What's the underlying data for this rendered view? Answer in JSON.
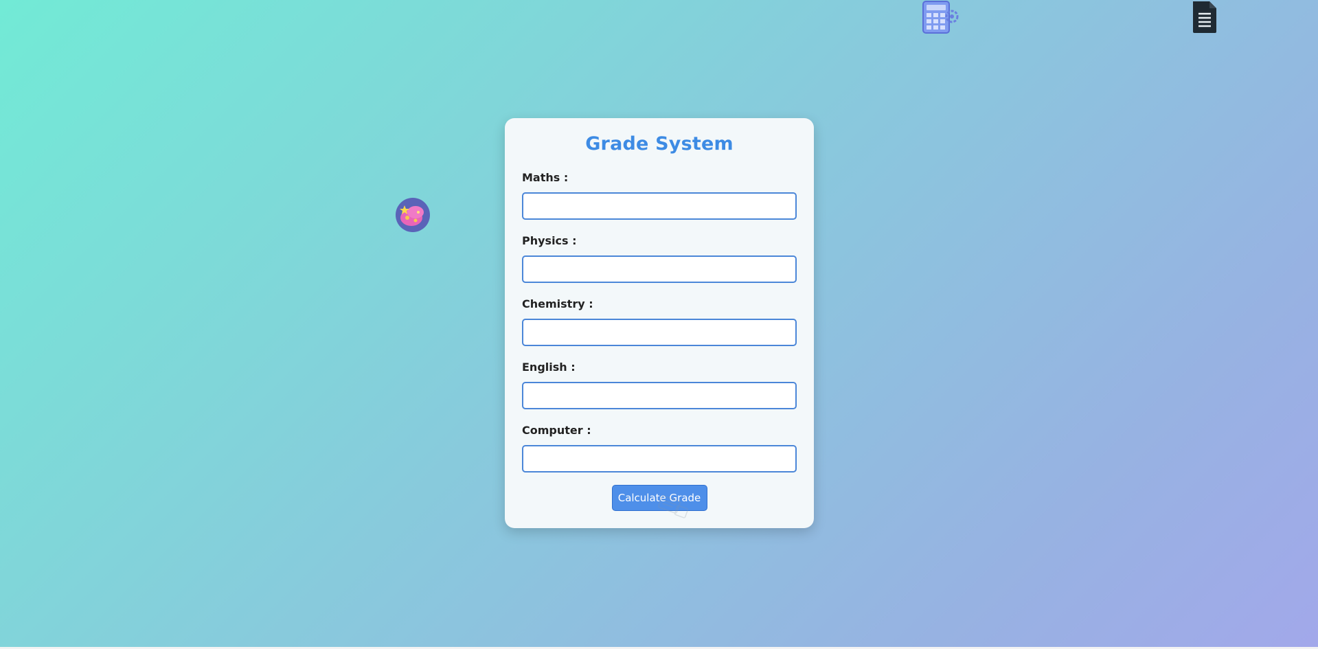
{
  "form": {
    "title": "Grade System",
    "fields": [
      {
        "label": "Maths :",
        "value": "",
        "placeholder": ""
      },
      {
        "label": "Physics :",
        "value": "",
        "placeholder": ""
      },
      {
        "label": "Chemistry :",
        "value": "",
        "placeholder": ""
      },
      {
        "label": "English :",
        "value": "",
        "placeholder": ""
      },
      {
        "label": "Computer :",
        "value": "",
        "placeholder": ""
      }
    ],
    "submit_label": "Calculate Grade"
  },
  "decorations": {
    "icons": [
      "calculator-icon",
      "document-icon",
      "sticker-ball-icon",
      "watermark-icon"
    ]
  },
  "colors": {
    "accent": "#3d8be4",
    "button": "#4e8fe9",
    "input_border": "#4a86d8",
    "card_bg": "#f3f8fa"
  }
}
